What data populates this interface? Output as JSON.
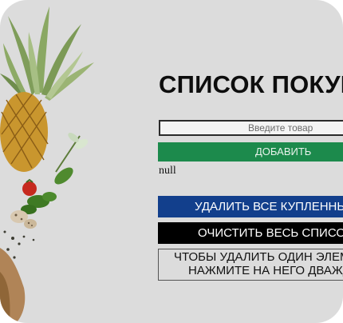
{
  "page": {
    "title": "СПИСОК ПОКУПОК"
  },
  "form": {
    "input_placeholder": "Введите товар",
    "add_label": "ДОБАВИТЬ"
  },
  "list": {
    "empty_text": "null"
  },
  "actions": {
    "delete_bought_label": "УДАЛИТЬ ВСЕ КУПЛЕННЫЕ",
    "clear_all_label": "ОЧИСТИТЬ ВЕСЬ СПИСОК"
  },
  "hint": {
    "line1": "ЧТОБЫ УДАЛИТЬ ОДИН ЭЛЕМЕНТ",
    "line2": "НАЖМИТЕ НА НЕГО ДВАЖДЫ"
  },
  "colors": {
    "background": "#dcdcdc",
    "add_button": "#1c8a4c",
    "delete_button": "#123f8c",
    "clear_button": "#000000"
  },
  "decor": {
    "image": "pineapple-and-vegetables-illustration"
  }
}
